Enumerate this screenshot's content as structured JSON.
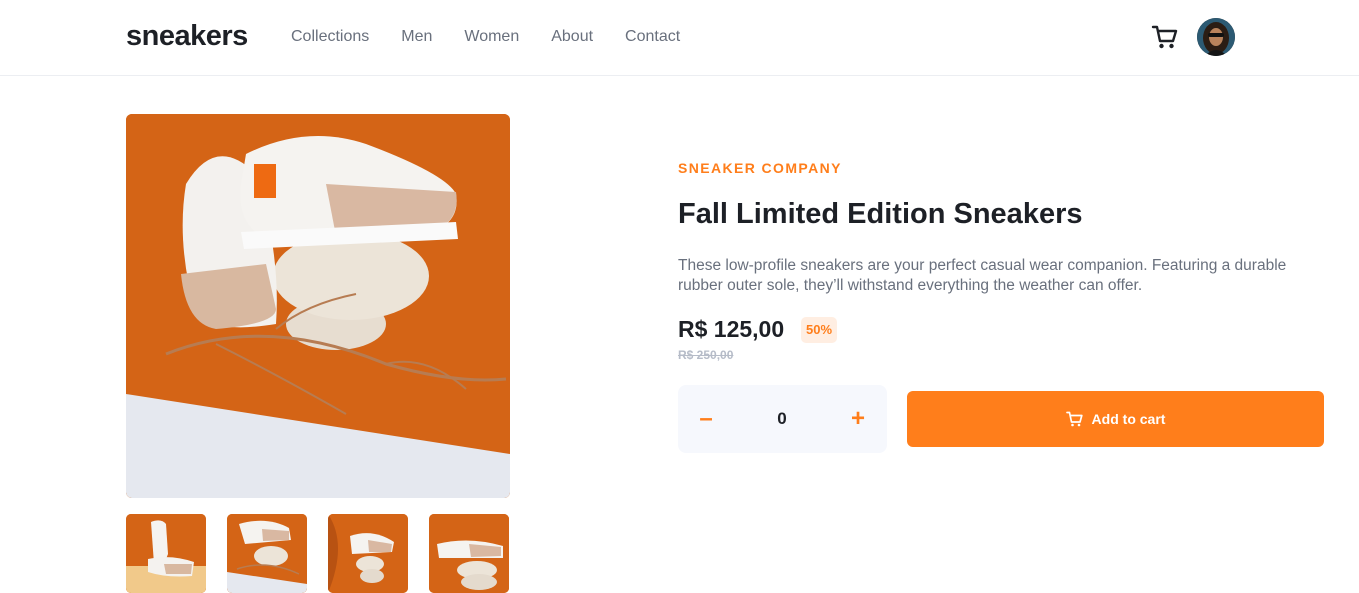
{
  "header": {
    "logo": "sneakers",
    "nav": [
      "Collections",
      "Men",
      "Women",
      "About",
      "Contact"
    ]
  },
  "product": {
    "company": "SNEAKER COMPANY",
    "title": "Fall Limited Edition Sneakers",
    "description": "These low-profile sneakers are your perfect casual wear companion. Featuring a durable rubber outer sole, they’ll withstand everything the weather can offer.",
    "price": "R$ 125,00",
    "discount": "50%",
    "old_price": "R$ 250,00"
  },
  "quantity": {
    "minus": "–",
    "value": "0",
    "plus": "+"
  },
  "cart": {
    "add_label": "Add to cart"
  },
  "colors": {
    "accent": "#ff7e1b",
    "accent_pale": "#ffeee2",
    "dark": "#1d2026",
    "muted": "#69707d"
  },
  "icons": [
    "cart-icon",
    "avatar"
  ]
}
